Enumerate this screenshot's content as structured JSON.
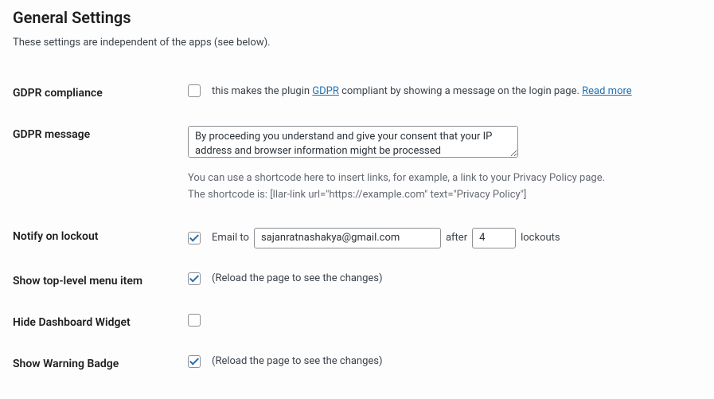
{
  "section": {
    "title": "General Settings",
    "description": "These settings are independent of the apps (see below)."
  },
  "gdpr_compliance": {
    "label": "GDPR compliance",
    "checked": false,
    "text_before": "this makes the plugin ",
    "link_gdpr": "GDPR",
    "text_middle": " compliant by showing a message on the login page. ",
    "link_readmore": "Read more"
  },
  "gdpr_message": {
    "label": "GDPR message",
    "value": "By proceeding you understand and give your consent that your IP address and browser information might be processed",
    "hint_line1": "You can use a shortcode here to insert links, for example, a link to your Privacy Policy page.",
    "hint_line2": "The shortcode is: [llar-link url=\"https://example.com\" text=\"Privacy Policy\"]"
  },
  "notify_lockout": {
    "label": "Notify on lockout",
    "checked": true,
    "email_to_label": "Email to",
    "email_value": "sajanratnashakya@gmail.com",
    "after_label": "after",
    "lockouts_value": "4",
    "lockouts_label": "lockouts"
  },
  "show_top_menu": {
    "label": "Show top-level menu item",
    "checked": true,
    "note": "(Reload the page to see the changes)"
  },
  "hide_dashboard": {
    "label": "Hide Dashboard Widget",
    "checked": false
  },
  "show_warning_badge": {
    "label": "Show Warning Badge",
    "checked": true,
    "note": "(Reload the page to see the changes)"
  }
}
